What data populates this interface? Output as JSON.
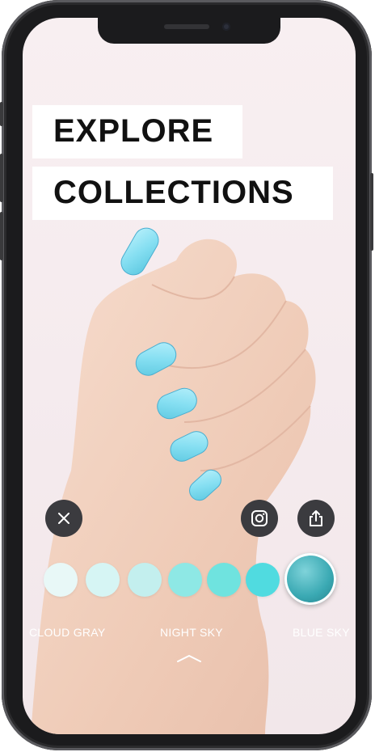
{
  "app": {
    "title_line1": "EXPLORE",
    "title_line2": "COLLECTIONS"
  },
  "controls": {
    "close_icon": "close-icon",
    "instagram_icon": "instagram-icon",
    "share_icon": "share-icon",
    "expand_icon": "chevron-up-icon"
  },
  "swatches": [
    {
      "color": "#e8f8f7",
      "selected": false
    },
    {
      "color": "#d6f5f4",
      "selected": false
    },
    {
      "color": "#c3efee",
      "selected": false
    },
    {
      "color": "#8ee8e5",
      "selected": false
    },
    {
      "color": "#6fe3df",
      "selected": false
    },
    {
      "color": "#50dbe0",
      "selected": false
    },
    {
      "color": "#3aa9b3",
      "selected": true
    }
  ],
  "labels": {
    "left": "CLOUD GRAY",
    "center": "NIGHT SKY",
    "right": "BLUE SKY"
  },
  "colors": {
    "nail": "#86dff2",
    "skin": "#f2d3c2",
    "button_bg": "#3b3b3f"
  }
}
